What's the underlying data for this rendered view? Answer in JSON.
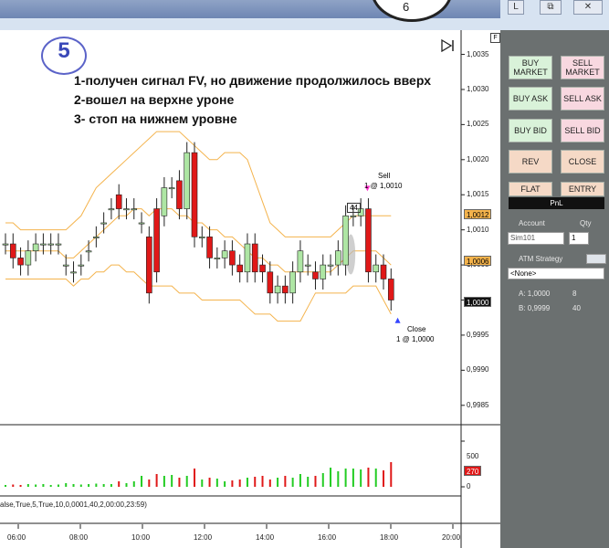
{
  "badge_number": "5",
  "annotations": [
    "1-получен сигнал FV, но движение продолжилось вверх",
    "2-вошел на верхне уроне",
    "3- стоп на нижнем уровне"
  ],
  "window": {
    "clock_digit": "6",
    "btn_l": "L",
    "btn_restore": "⧉",
    "btn_close": "✕",
    "corner_f": "F",
    "play_icon": "play-end-icon"
  },
  "y_axis": {
    "labels": [
      "1,0035",
      "1,0030",
      "1,0025",
      "1,0020",
      "1,0015",
      "1,0010",
      "1,0005",
      "1,0000",
      "0,9995",
      "0,9990",
      "0,9985"
    ],
    "min": 0.99825,
    "max": 1.00365
  },
  "price_tags": {
    "upper": "1,0012",
    "middle": "1,0006",
    "current": "1,0000"
  },
  "volume": {
    "labels": [
      "500",
      "0"
    ],
    "current_tag": "270"
  },
  "x_axis": {
    "labels": [
      "06:00",
      "08:00",
      "10:00",
      "12:00",
      "14:00",
      "16:00",
      "18:00",
      "20:00"
    ]
  },
  "indicator_params": "alse,True,5,True,10,0,0001,40,2,00:00,23:59)",
  "markers": {
    "sell_label": "Sell",
    "sell_detail": "1 @ 1,0010",
    "close_label": "Close",
    "close_detail": "1 @ 1,0000",
    "box_label": "44"
  },
  "chart_data": {
    "type": "candlestick",
    "x": [
      "05:45",
      "06:00",
      "06:15",
      "06:30",
      "06:45",
      "07:00",
      "07:15",
      "07:30",
      "07:45",
      "08:00",
      "08:15",
      "08:30",
      "08:45",
      "09:00",
      "09:15",
      "09:30",
      "09:45",
      "10:00",
      "10:15",
      "10:30",
      "10:45",
      "11:00",
      "11:15",
      "11:30",
      "11:45",
      "12:00",
      "12:15",
      "12:30",
      "12:45",
      "13:00",
      "13:15",
      "13:30",
      "13:45",
      "14:00",
      "14:15",
      "14:30",
      "14:45",
      "15:00",
      "15:15",
      "15:30",
      "15:45",
      "16:00",
      "16:15",
      "16:30",
      "16:45",
      "17:00",
      "17:15",
      "17:30",
      "17:45",
      "18:00",
      "18:15",
      "18:30"
    ],
    "open": [
      1.0008,
      1.0008,
      1.0006,
      1.0005,
      1.0007,
      1.0008,
      1.0008,
      1.0008,
      1.0005,
      1.0004,
      1.0005,
      1.0007,
      1.0009,
      1.0011,
      1.0013,
      1.0015,
      1.0013,
      1.0013,
      1.0011,
      1.0009,
      1.0013,
      1.0012,
      1.0016,
      1.0017,
      1.0013,
      1.0021,
      1.0009,
      1.0009,
      1.0006,
      1.0006,
      1.0007,
      1.0005,
      1.0004,
      1.0008,
      1.0005,
      1.0004,
      1.0001,
      1.0002,
      1.0001,
      1.0004,
      1.0005,
      1.0004,
      1.0003,
      1.0005,
      1.0005,
      1.0005,
      1.0012,
      1.0012,
      1.0013,
      1.0004,
      1.0005,
      1.0003
    ],
    "close": [
      1.0008,
      1.0006,
      1.0005,
      1.0007,
      1.0008,
      1.0008,
      1.0008,
      1.0008,
      1.0005,
      1.0004,
      1.0005,
      1.0007,
      1.0009,
      1.0011,
      1.0013,
      1.0013,
      1.0013,
      1.0013,
      1.0011,
      1.0001,
      1.0004,
      1.0016,
      1.0016,
      1.0013,
      1.0021,
      1.0009,
      1.0009,
      1.0006,
      1.0006,
      1.0007,
      1.0005,
      1.0004,
      1.0008,
      1.0004,
      1.0004,
      1.0001,
      1.0002,
      1.0001,
      1.0004,
      1.0007,
      1.0005,
      1.0003,
      1.0005,
      1.0005,
      1.0007,
      1.0012,
      1.0012,
      1.0013,
      1.0004,
      1.0005,
      1.0003,
      1.0
    ],
    "bollinger_upper": [
      1.0011,
      1.0011,
      1.001,
      1.001,
      1.001,
      1.001,
      1.001,
      1.001,
      1.001,
      1.0011,
      1.0012,
      1.0014,
      1.0016,
      1.0017,
      1.0018,
      1.0019,
      1.002,
      1.0021,
      1.0022,
      1.0023,
      1.0024,
      1.0024,
      1.0024,
      1.0024,
      1.0023,
      1.0022,
      1.0021,
      1.002,
      1.002,
      1.0021,
      1.0021,
      1.0021,
      1.002,
      1.0017,
      1.0014,
      1.0011,
      1.001,
      1.0009,
      1.0009,
      1.0009,
      1.0009,
      1.0009,
      1.0009,
      1.0009,
      1.001,
      1.0011,
      1.0012,
      1.0012,
      1.0012,
      1.0012,
      1.0012,
      1.0012
    ],
    "bollinger_mid": [
      1.0007,
      1.0007,
      1.0007,
      1.0007,
      1.0007,
      1.0007,
      1.0007,
      1.0007,
      1.0006,
      1.0006,
      1.0007,
      1.0008,
      1.0009,
      1.001,
      1.0011,
      1.0012,
      1.0012,
      1.0013,
      1.0013,
      1.0012,
      1.0013,
      1.0013,
      1.0013,
      1.0012,
      1.0012,
      1.0011,
      1.0011,
      1.001,
      1.001,
      1.0009,
      1.0009,
      1.0008,
      1.0007,
      1.0006,
      1.0006,
      1.0005,
      1.0005,
      1.0004,
      1.0004,
      1.0004,
      1.0004,
      1.0004,
      1.0004,
      1.0004,
      1.0005,
      1.0006,
      1.0007,
      1.0007,
      1.0007,
      1.0007,
      1.0006,
      1.0005
    ],
    "bollinger_lower": [
      1.0003,
      1.0003,
      1.0003,
      1.0003,
      1.0003,
      1.0003,
      1.0003,
      1.0003,
      1.0003,
      1.0002,
      1.0003,
      1.0003,
      1.0004,
      1.0004,
      1.0005,
      1.0005,
      1.0004,
      1.0004,
      1.0003,
      1.0002,
      1.0002,
      1.0002,
      1.0002,
      1.0001,
      1.0001,
      1.0001,
      1.0,
      1.0,
      1.0,
      1.0,
      1.0,
      1.0,
      0.9999,
      0.9998,
      0.9998,
      0.9998,
      0.9997,
      0.9997,
      0.9997,
      0.9997,
      0.9999,
      1.0001,
      1.0001,
      1.0001,
      1.0001,
      1.0001,
      1.0002,
      1.0002,
      1.0002,
      1.0002,
      1.0,
      0.9998
    ],
    "volume": [
      20,
      25,
      20,
      30,
      25,
      30,
      20,
      25,
      40,
      30,
      25,
      30,
      35,
      30,
      30,
      60,
      40,
      60,
      120,
      80,
      140,
      120,
      130,
      100,
      120,
      200,
      80,
      100,
      90,
      60,
      70,
      80,
      100,
      110,
      120,
      80,
      100,
      120,
      100,
      140,
      110,
      120,
      150,
      210,
      170,
      200,
      200,
      190,
      210,
      200,
      180,
      270
    ],
    "colors": {
      "up": "#aee6a4",
      "down": "#e01818",
      "band": "#f4b34c",
      "volume_up": "#22cc22",
      "volume_down": "#e01818"
    }
  },
  "panel": {
    "buy_market": "BUY\nMARKET",
    "sell_market": "SELL\nMARKET",
    "buy_ask": "BUY ASK",
    "sell_ask": "SELL ASK",
    "buy_bid": "BUY BID",
    "sell_bid": "SELL BID",
    "rev": "REV",
    "close": "CLOSE",
    "flat": "FLAT",
    "entry": "ENTRY",
    "pnl": "PnL",
    "account_label": "Account",
    "qty_label": "Qty",
    "account_value": "Sim101",
    "qty_value": "1",
    "atm_label": "ATM Strategy",
    "atm_value": "<None>",
    "ask_label": "A: 1,0000",
    "ask_size": "8",
    "bid_label": "B: 0,9999",
    "bid_size": "40"
  }
}
